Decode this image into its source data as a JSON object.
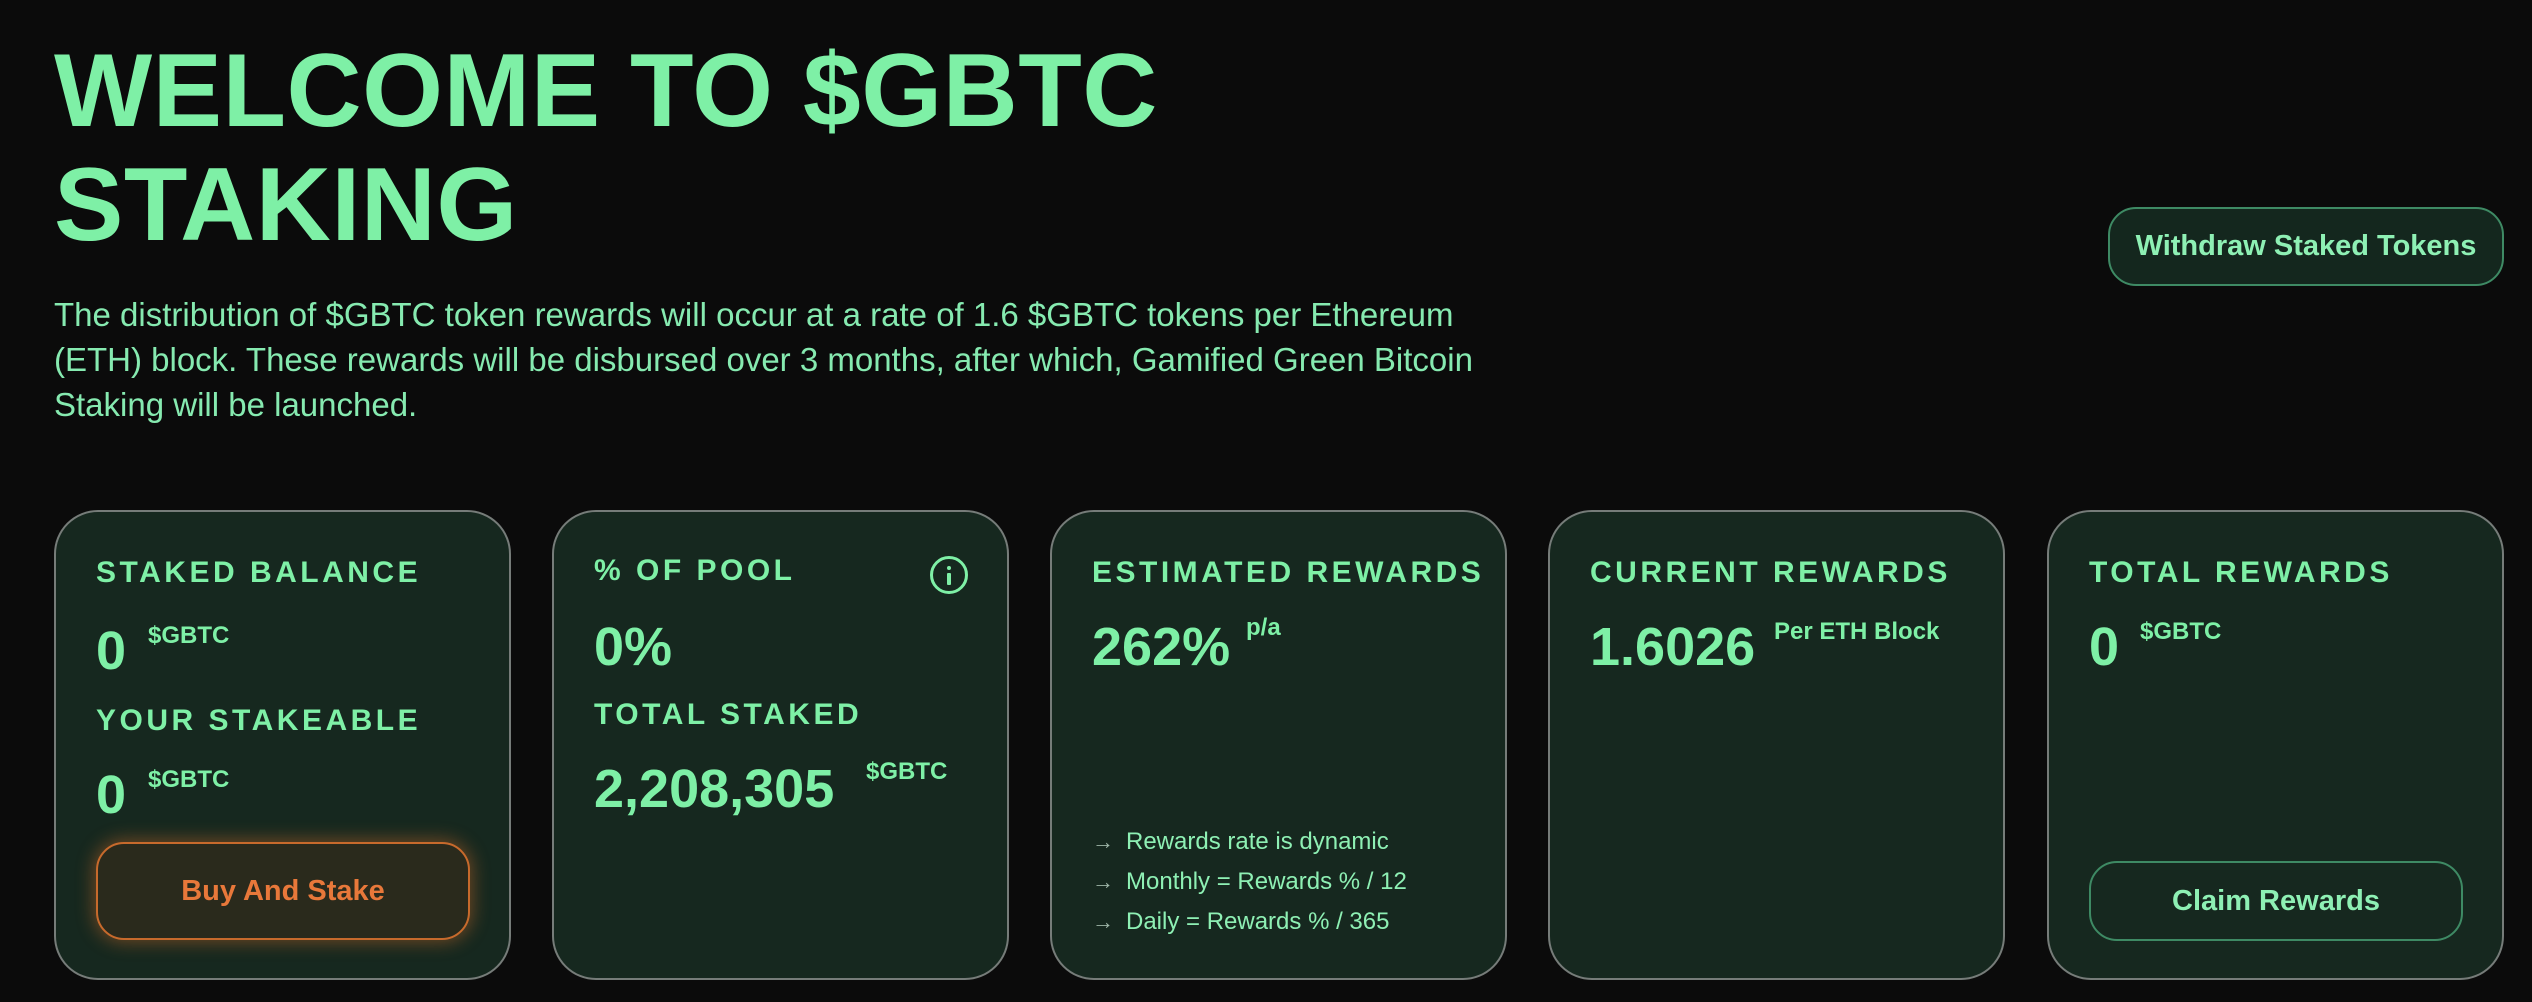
{
  "hero": {
    "title_line1": "WELCOME TO $GBTC",
    "title_line2": "STAKING",
    "description": "The distribution of $GBTC token rewards will occur at a rate of 1.6 $GBTC tokens per Ethereum (ETH) block. These rewards will be disbursed over 3 months, after which, Gamified Green Bitcoin Staking will be launched."
  },
  "withdraw_button": "Withdraw Staked Tokens",
  "cards": {
    "staked_balance": {
      "label": "STAKED BALANCE",
      "value": "0",
      "unit": "$GBTC",
      "stakeable_label": "YOUR STAKEABLE",
      "stakeable_value": "0",
      "stakeable_unit": "$GBTC",
      "button": "Buy And Stake"
    },
    "pool": {
      "label": "% OF POOL",
      "icon": "info-icon",
      "value": "0%",
      "total_label": "TOTAL STAKED",
      "total_value": "2,208,305",
      "total_unit": "$GBTC"
    },
    "estimated": {
      "label": "ESTIMATED REWARDS",
      "value": "262%",
      "unit": "p/a",
      "notes": [
        "Rewards rate is dynamic",
        "Monthly = Rewards % / 12",
        "Daily = Rewards % / 365"
      ]
    },
    "current": {
      "label": "CURRENT REWARDS",
      "value": "1.6026",
      "unit": "Per ETH Block"
    },
    "total": {
      "label": "TOTAL REWARDS",
      "value": "0",
      "unit": "$GBTC",
      "button": "Claim Rewards"
    }
  },
  "colors": {
    "accent": "#7ef0a6",
    "background": "#0b0b0b",
    "card_background": "#16281f",
    "buy_button": "#e8783a"
  }
}
